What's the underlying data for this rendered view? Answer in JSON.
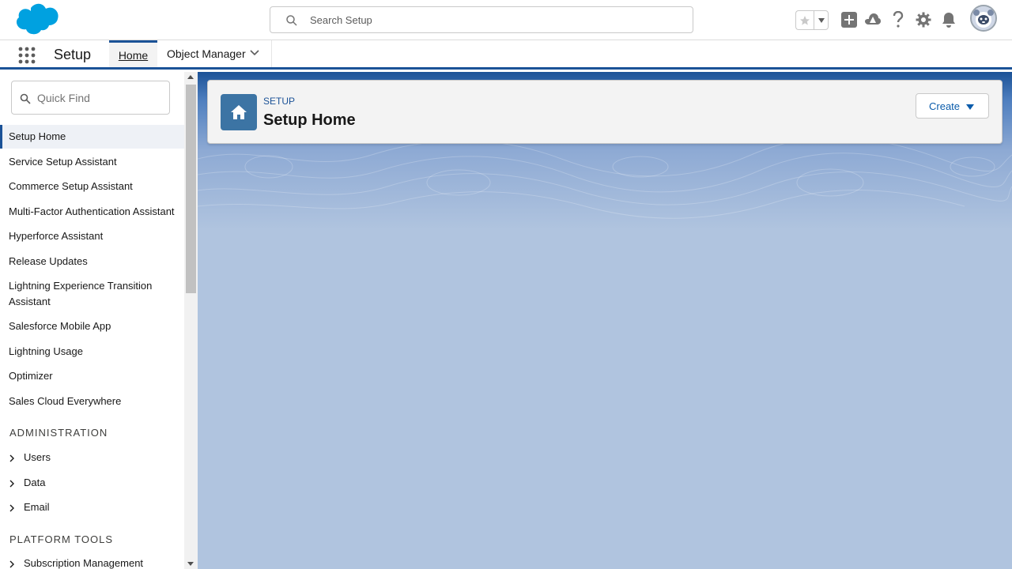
{
  "header": {
    "logo": "salesforce-cloud-logo",
    "search_placeholder": "Search Setup",
    "icons": [
      "star-icon",
      "chevron-down-icon",
      "add-icon",
      "trailhead-icon",
      "help-icon",
      "gear-icon",
      "bell-icon",
      "avatar"
    ]
  },
  "context_bar": {
    "app_name": "Setup",
    "tabs": [
      {
        "label": "Home"
      },
      {
        "label": "Object Manager"
      }
    ]
  },
  "sidebar": {
    "quick_find_placeholder": "Quick Find",
    "items": [
      {
        "label": "Setup Home"
      },
      {
        "label": "Service Setup Assistant"
      },
      {
        "label": "Commerce Setup Assistant"
      },
      {
        "label": "Multi-Factor Authentication Assistant"
      },
      {
        "label": "Hyperforce Assistant"
      },
      {
        "label": "Release Updates"
      },
      {
        "label": "Lightning Experience Transition Assistant"
      },
      {
        "label": "Salesforce Mobile App"
      },
      {
        "label": "Lightning Usage"
      },
      {
        "label": "Optimizer"
      },
      {
        "label": "Sales Cloud Everywhere"
      }
    ],
    "sections": [
      {
        "title": "ADMINISTRATION",
        "items": [
          {
            "label": "Users"
          },
          {
            "label": "Data"
          },
          {
            "label": "Email"
          }
        ]
      },
      {
        "title": "PLATFORM TOOLS",
        "items": [
          {
            "label": "Subscription Management"
          }
        ]
      }
    ]
  },
  "main": {
    "eyebrow": "SETUP",
    "title": "Setup Home",
    "create_label": "Create"
  },
  "colors": {
    "brand": "#1b5297",
    "link": "#0b5cab",
    "background": "#b0c4df",
    "logo_blue": "#00a1e0"
  }
}
